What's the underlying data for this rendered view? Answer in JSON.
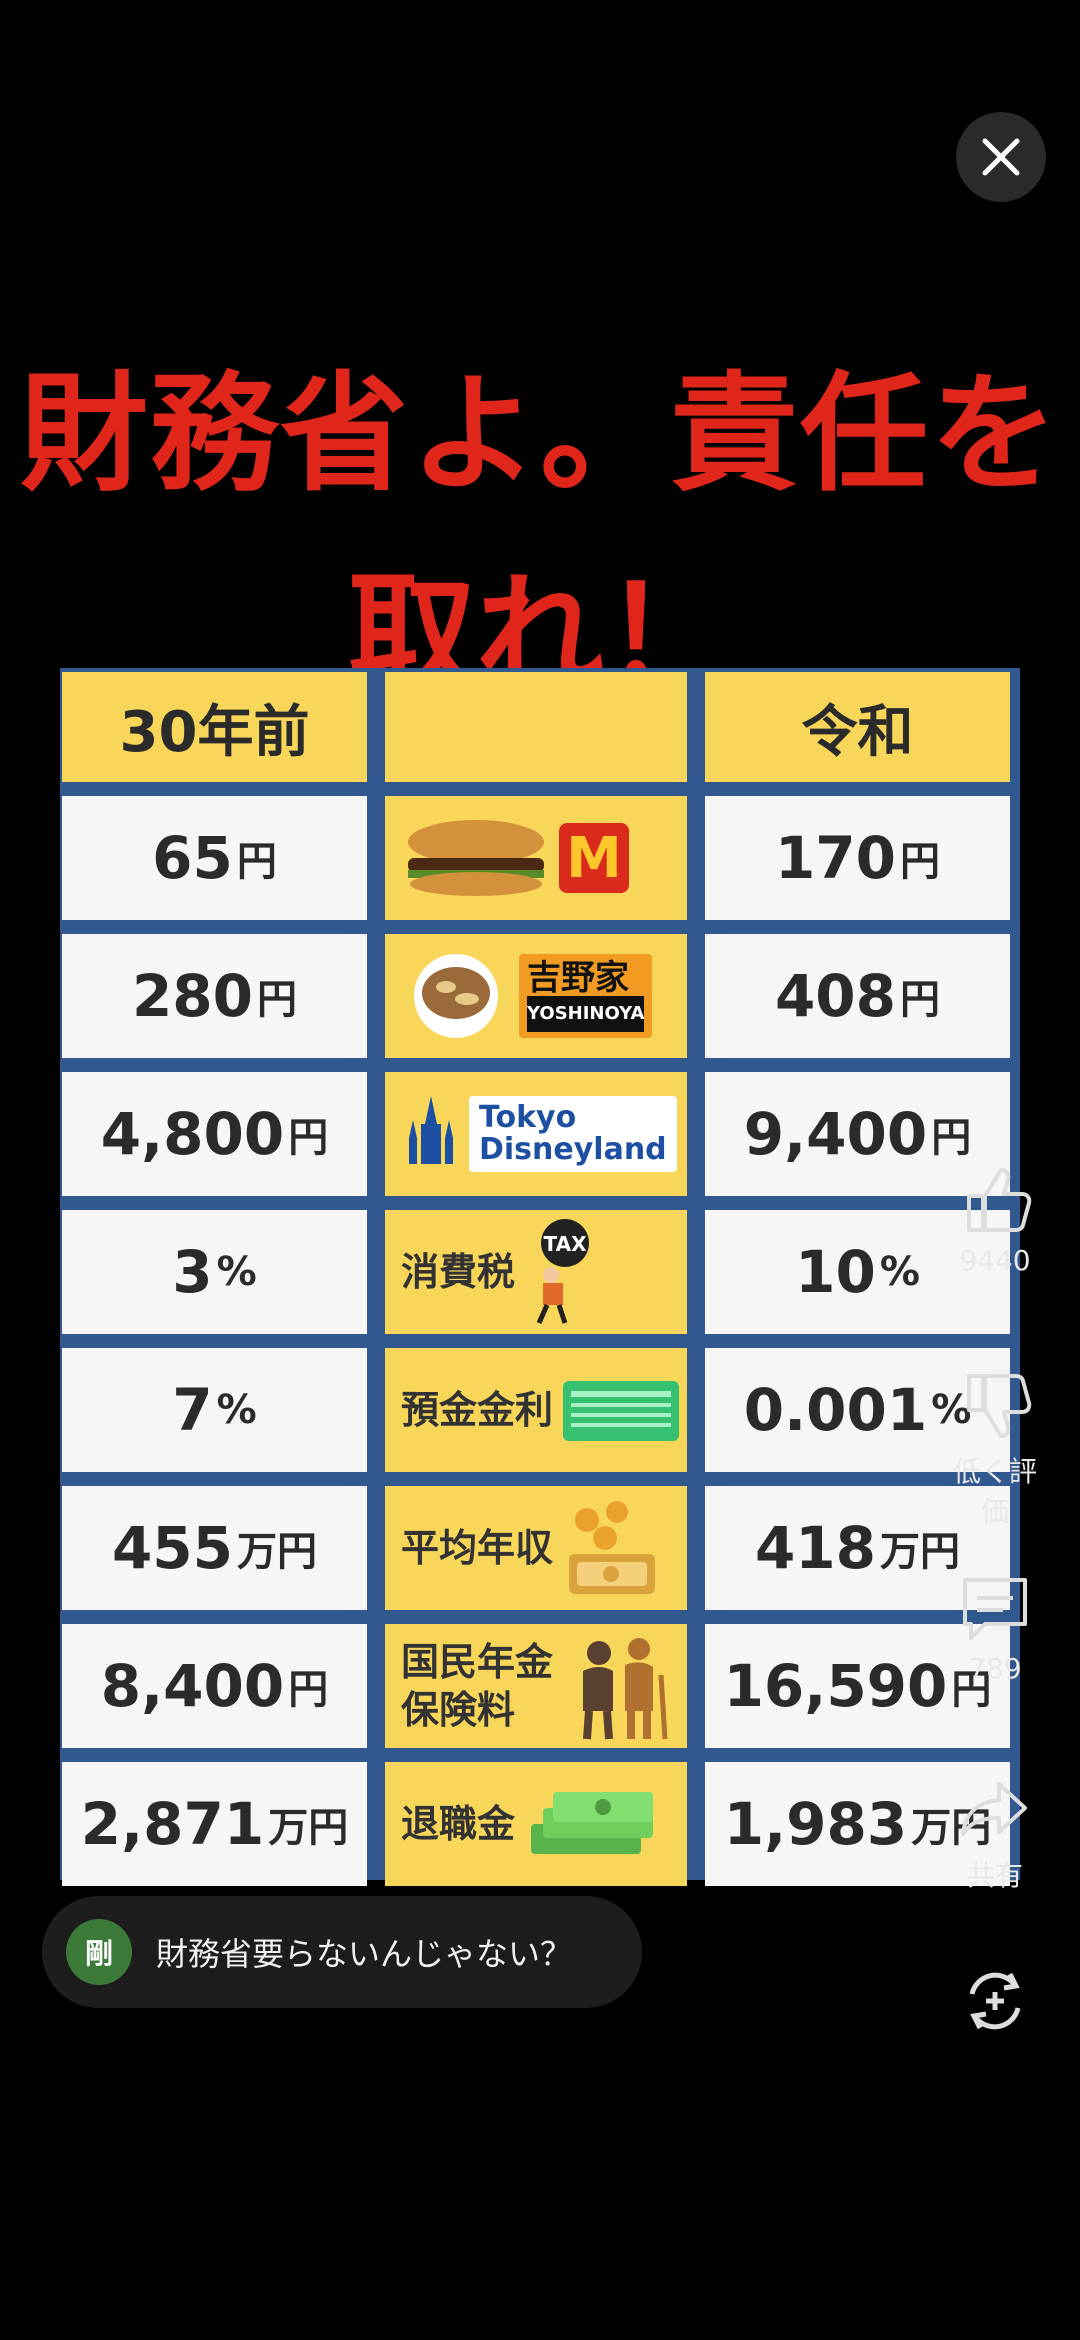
{
  "headline": {
    "line1": "財務省よ。責任を",
    "line2": "取れ！"
  },
  "table": {
    "headers": {
      "left": "30年前",
      "middle": "",
      "right": "令和"
    },
    "rows": [
      {
        "left": "65",
        "left_unit": "円",
        "middle": "",
        "icon": "hamburger-icon",
        "brand": "M",
        "right": "170",
        "right_unit": "円"
      },
      {
        "left": "280",
        "left_unit": "円",
        "middle": "",
        "icon": "gyudon-icon",
        "brand": "吉野家",
        "brand_sub": "YOSHINOYA",
        "right": "408",
        "right_unit": "円"
      },
      {
        "left": "4,800",
        "left_unit": "円",
        "middle": "",
        "icon": "castle-icon",
        "brand": "Tokyo",
        "brand_sub": "Disneyland",
        "right": "9,400",
        "right_unit": "円"
      },
      {
        "left": "3",
        "left_unit": "%",
        "middle": "消費税",
        "icon": "tax-icon",
        "badge": "TAX",
        "right": "10",
        "right_unit": "%"
      },
      {
        "left": "7",
        "left_unit": "%",
        "middle": "預金金利",
        "icon": "bankbook-icon",
        "right": "0.001",
        "right_unit": "%"
      },
      {
        "left": "455",
        "left_unit": "万円",
        "middle": "平均年収",
        "icon": "coins-icon",
        "right": "418",
        "right_unit": "万円"
      },
      {
        "left": "8,400",
        "left_unit": "円",
        "middle": "国民年金\n保険料",
        "icon": "elderly-icon",
        "right": "16,590",
        "right_unit": "円"
      },
      {
        "left": "2,871",
        "left_unit": "万円",
        "middle": "退職金",
        "icon": "money-stack-icon",
        "right": "1,983",
        "right_unit": "万円"
      }
    ]
  },
  "rail": {
    "like_count": "9440",
    "dislike_label": "低く評価",
    "comment_count": "789",
    "share_label": "共有"
  },
  "comment": {
    "avatar_text": "剛",
    "text": "財務省要らないんじゃない？"
  },
  "colors": {
    "headline": "#e0261a",
    "cell_yellow": "#f8d65a",
    "cell_white": "#f6f6f6",
    "grid_blue": "#31588f"
  }
}
